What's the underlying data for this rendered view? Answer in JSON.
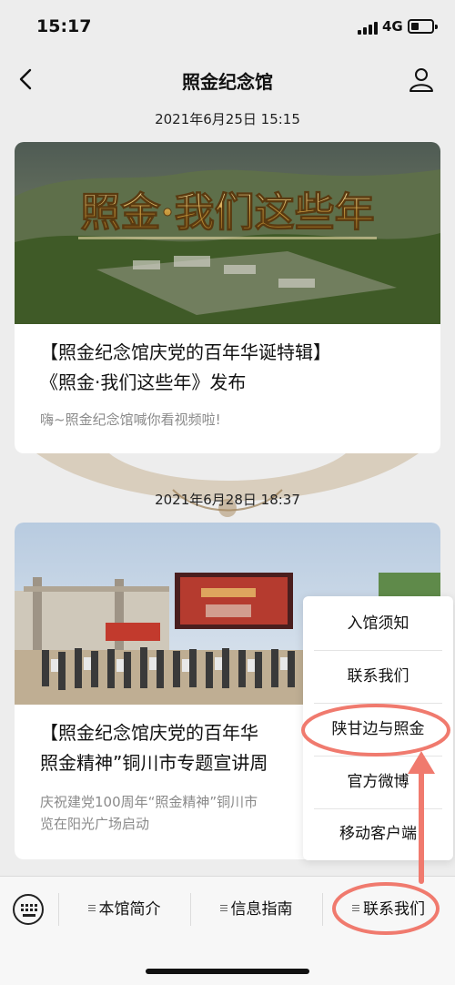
{
  "status_bar": {
    "time": "15:17",
    "network": "4G"
  },
  "nav": {
    "title": "照金纪念馆"
  },
  "feed": {
    "items": [
      {
        "timestamp": "2021年6月25日 15:15",
        "image_caption": "照金·我们这些年",
        "title": "【照金纪念馆庆党的百年华诞特辑】\n《照金·我们这些年》发布",
        "description": "嗨~照金纪念馆喊你看视频啦!"
      },
      {
        "timestamp": "2021年6月28日 18:37",
        "title": "【照金纪念馆庆党的百年华\n照金精神”铜川市专题宣讲周",
        "description": "庆祝建党100周年“照金精神”铜川市\n览在阳光广场启动"
      }
    ]
  },
  "popup_menu": {
    "items": [
      "入馆须知",
      "联系我们",
      "陕甘边与照金",
      "官方微博",
      "移动客户端"
    ]
  },
  "bottom_menu": {
    "tabs": [
      "本馆简介",
      "信息指南",
      "联系我们"
    ]
  },
  "colors": {
    "annotation": "#f07a6e",
    "background": "#ededed"
  },
  "icons": {
    "back": "chevron-left-icon",
    "profile": "person-icon",
    "keyboard": "keyboard-icon",
    "menu": "menu-lines-icon"
  }
}
